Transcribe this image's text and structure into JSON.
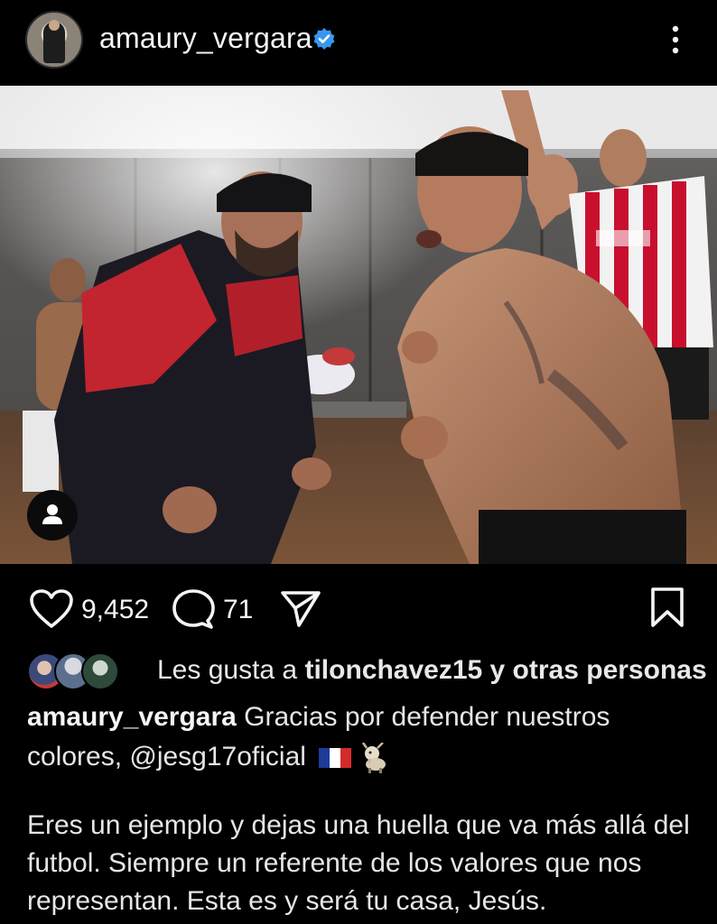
{
  "post": {
    "username": "amaury_vergara",
    "verified": true,
    "image_alt": "Celebración en el vestuario"
  },
  "actions": {
    "like_icon": "heart-icon",
    "like_count": "9,452",
    "comment_icon": "comment-icon",
    "comment_count": "71",
    "share_icon": "send-icon",
    "save_icon": "bookmark-icon"
  },
  "likes": {
    "prefix": "Les gusta a ",
    "user": "tilonchavez15",
    "suffix": " y otras personas"
  },
  "caption": {
    "username": "amaury_vergara",
    "line1": " Gracias por defender nuestros",
    "line2_text": "colores, @jesg17oficial",
    "flag": "france-flag-emoji",
    "goat": "goat-emoji",
    "paragraph": "Eres un ejemplo y dejas una huella que va más allá del futbol. Siempre un referente de los valores que nos representan. Esta es y será tu casa, Jesús."
  },
  "colors": {
    "background": "#000000",
    "text": "#f5f5f5",
    "verified": "#3897f0"
  }
}
